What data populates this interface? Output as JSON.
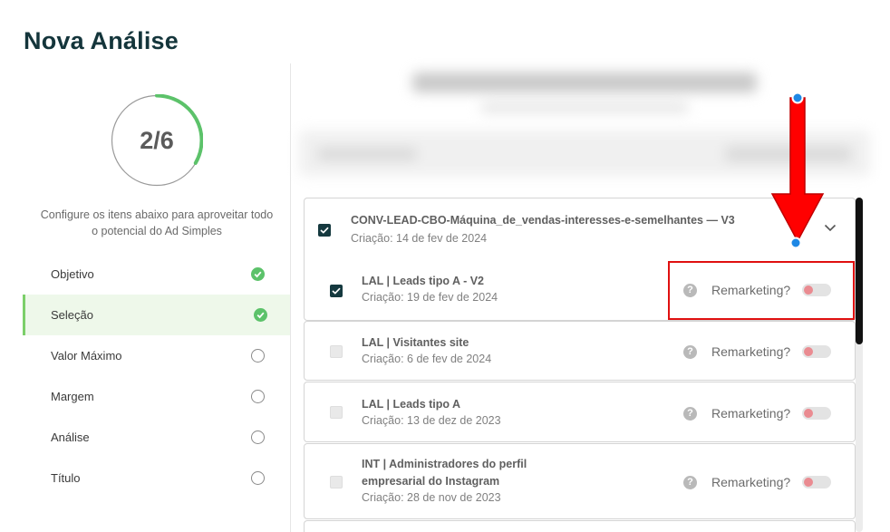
{
  "page": {
    "title": "Nova Análise"
  },
  "sidebar": {
    "progress": {
      "label": "2/6",
      "current": 2,
      "total": 6,
      "color": "#5cc26a"
    },
    "hint": "Configure os itens abaixo para aproveitar todo o potencial do Ad Simples",
    "steps": [
      {
        "label": "Objetivo",
        "status": "done"
      },
      {
        "label": "Seleção",
        "status": "done",
        "active": true
      },
      {
        "label": "Valor Máximo",
        "status": "todo"
      },
      {
        "label": "Margem",
        "status": "todo"
      },
      {
        "label": "Análise",
        "status": "todo"
      },
      {
        "label": "Título",
        "status": "todo"
      }
    ]
  },
  "list": {
    "group": {
      "name": "CONV-LEAD-CBO-Máquina_de_vendas-interesses-e-semelhantes — V3",
      "date": "Criação: 14 de fev de 2024",
      "checked": true,
      "expanded": true,
      "items": [
        {
          "name": "LAL | Leads tipo A - V2",
          "date": "Criação: 19 de fev de 2024",
          "checked": true,
          "remarketing_label": "Remarketing?"
        }
      ]
    },
    "items": [
      {
        "name": "LAL | Visitantes site",
        "date": "Criação: 6 de fev de 2024",
        "checked": false,
        "remarketing_label": "Remarketing?"
      },
      {
        "name": "LAL | Leads tipo A",
        "date": "Criação: 13 de dez de 2023",
        "checked": false,
        "remarketing_label": "Remarketing?"
      },
      {
        "name_line1": "INT | Administradores do perfil",
        "name_line2": "empresarial do Instagram",
        "date": "Criação: 28 de nov de 2023",
        "checked": false,
        "remarketing_label": "Remarketing?"
      }
    ]
  },
  "colors": {
    "brand_dark": "#15393f",
    "success": "#5cc26a",
    "toggle_off_knob": "#ea8b91",
    "annotation": "#e01010"
  },
  "icons": {
    "step_done": "check-circle-icon",
    "step_todo": "empty-circle-icon",
    "help": "question-circle-icon",
    "collapse": "chevron-down-icon",
    "help_glyph": "?"
  }
}
